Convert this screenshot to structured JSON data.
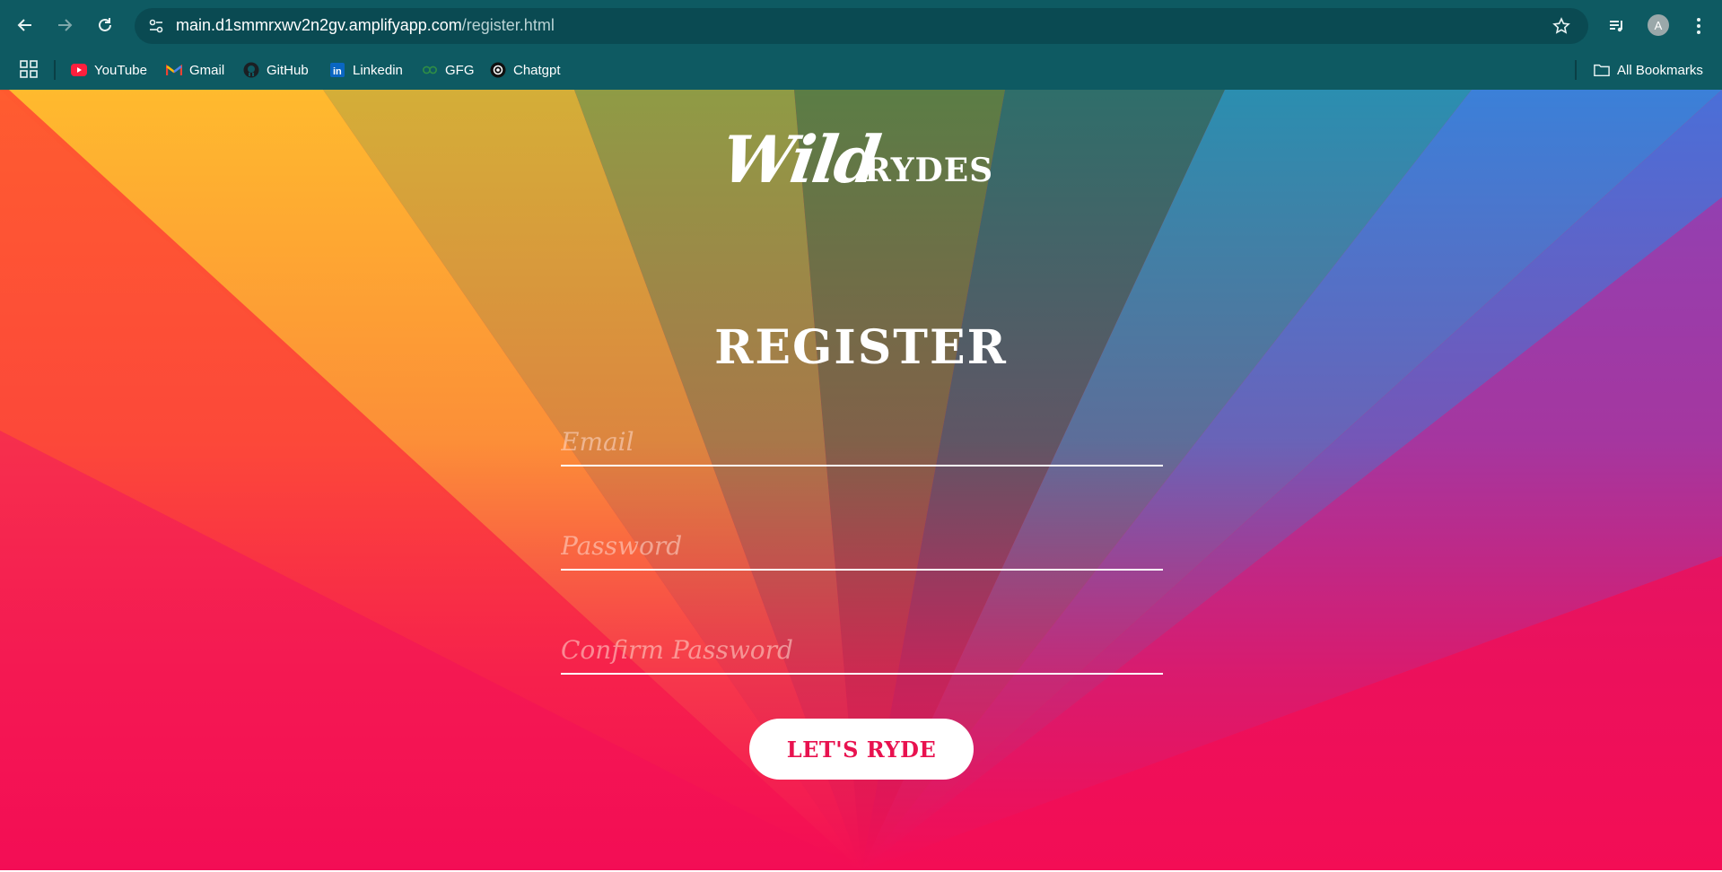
{
  "browser": {
    "url_host": "main.d1smmrxwv2n2gv.amplifyapp.com",
    "url_path": "/register.html",
    "profile_initial": "A",
    "bookmarks": [
      {
        "label": "YouTube",
        "icon": "youtube-icon"
      },
      {
        "label": "Gmail",
        "icon": "gmail-icon"
      },
      {
        "label": "GitHub",
        "icon": "github-icon"
      },
      {
        "label": "Linkedin",
        "icon": "linkedin-icon"
      },
      {
        "label": "GFG",
        "icon": "gfg-icon"
      },
      {
        "label": "Chatgpt",
        "icon": "chatgpt-icon"
      }
    ],
    "all_bookmarks_label": "All Bookmarks"
  },
  "page": {
    "logo_wild": "Wild",
    "logo_rydes": "RYDES",
    "title": "REGISTER",
    "email_placeholder": "Email",
    "password_placeholder": "Password",
    "confirm_placeholder": "Confirm Password",
    "submit_label": "LET'S RYDE"
  },
  "colors": {
    "chrome": "#0e5a62",
    "page_base": "#f30d55",
    "submit_text": "#e8124f"
  }
}
